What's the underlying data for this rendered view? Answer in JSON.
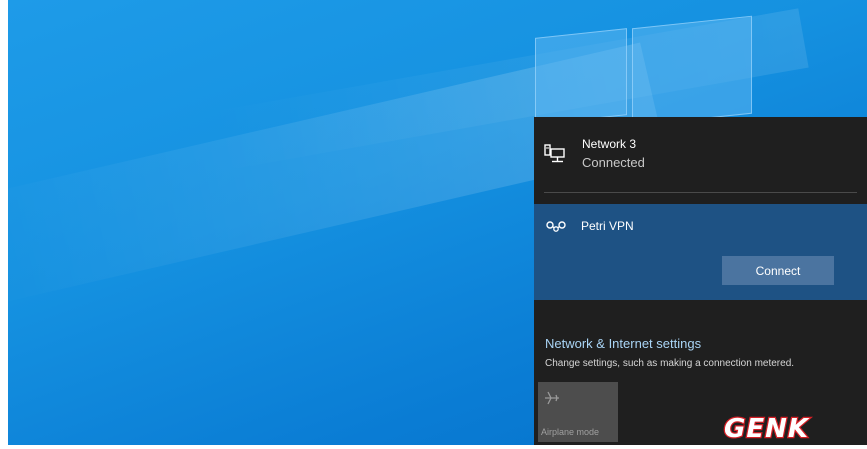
{
  "network": {
    "name": "Network 3",
    "status": "Connected",
    "icon": "wired-network-icon"
  },
  "vpn": {
    "name": "Petri VPN",
    "icon": "vpn-icon",
    "connect_label": "Connect"
  },
  "settings": {
    "title": "Network & Internet settings",
    "description": "Change settings, such as making a connection metered."
  },
  "quick_actions": {
    "airplane_label": "Airplane mode",
    "airplane_icon": "airplane-icon"
  },
  "watermark": {
    "text": "GENK"
  },
  "colors": {
    "flyout_bg": "#1f1f1f",
    "vpn_bg": "#1e5284",
    "connect_bg": "#4b74a0",
    "link": "#a9d4f5",
    "watermark_red": "#d61f26"
  }
}
